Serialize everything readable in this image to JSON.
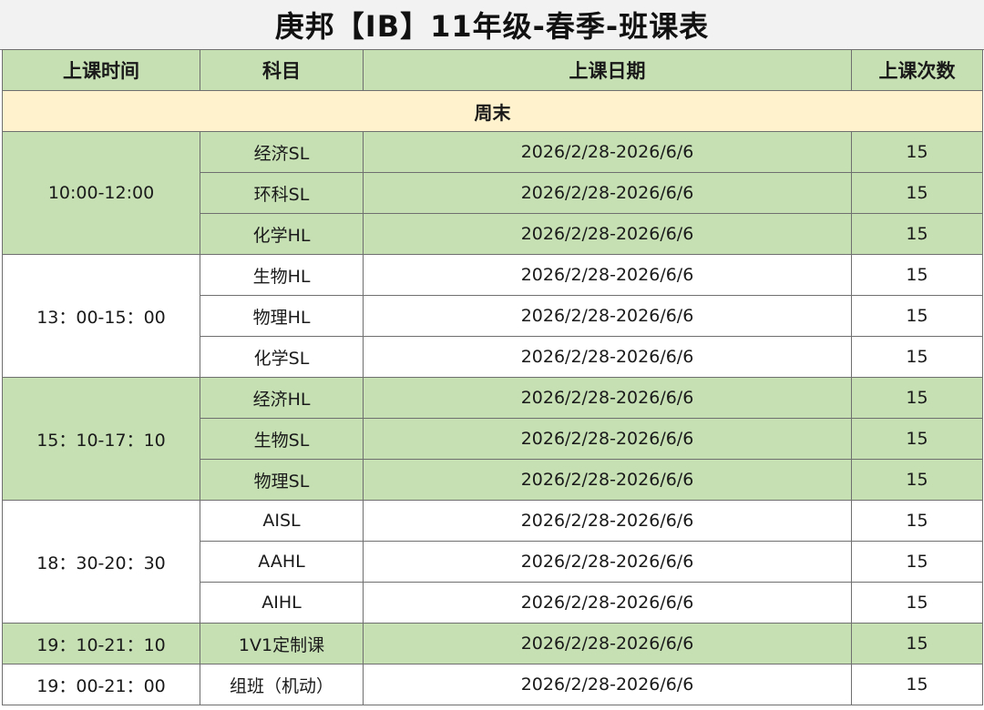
{
  "title": "庚邦【IB】11年级-春季-班课表",
  "headers": {
    "time": "上课时间",
    "subject": "科目",
    "date": "上课日期",
    "count": "上课次数"
  },
  "section": "周末",
  "colors": {
    "green": "#c6e0b4",
    "header_yellow": "#fff2cc",
    "white": "#ffffff",
    "title_bg": "#f2f2f2"
  },
  "groups": [
    {
      "time": "10:00-12:00",
      "shade": "green",
      "rows": [
        {
          "subject": "经济SL",
          "date": "2026/2/28-2026/6/6",
          "count": "15"
        },
        {
          "subject": "环科SL",
          "date": "2026/2/28-2026/6/6",
          "count": "15"
        },
        {
          "subject": "化学HL",
          "date": "2026/2/28-2026/6/6",
          "count": "15"
        }
      ]
    },
    {
      "time": "13：00-15：00",
      "shade": "white",
      "rows": [
        {
          "subject": "生物HL",
          "date": "2026/2/28-2026/6/6",
          "count": "15"
        },
        {
          "subject": "物理HL",
          "date": "2026/2/28-2026/6/6",
          "count": "15"
        },
        {
          "subject": "化学SL",
          "date": "2026/2/28-2026/6/6",
          "count": "15"
        }
      ]
    },
    {
      "time": "15：10-17：10",
      "shade": "green",
      "rows": [
        {
          "subject": "经济HL",
          "date": "2026/2/28-2026/6/6",
          "count": "15"
        },
        {
          "subject": "生物SL",
          "date": "2026/2/28-2026/6/6",
          "count": "15"
        },
        {
          "subject": "物理SL",
          "date": "2026/2/28-2026/6/6",
          "count": "15"
        }
      ]
    },
    {
      "time": "18：30-20：30",
      "shade": "white",
      "rows": [
        {
          "subject": "AISL",
          "date": "2026/2/28-2026/6/6",
          "count": "15"
        },
        {
          "subject": "AAHL",
          "date": "2026/2/28-2026/6/6",
          "count": "15"
        },
        {
          "subject": "AIHL",
          "date": "2026/2/28-2026/6/6",
          "count": "15"
        }
      ]
    },
    {
      "time": "19：10-21：10",
      "shade": "green",
      "rows": [
        {
          "subject": "1V1定制课",
          "date": "2026/2/28-2026/6/6",
          "count": "15"
        }
      ]
    },
    {
      "time": "19：00-21：00",
      "shade": "white",
      "rows": [
        {
          "subject": "组班（机动）",
          "date": "2026/2/28-2026/6/6",
          "count": "15"
        }
      ]
    }
  ]
}
